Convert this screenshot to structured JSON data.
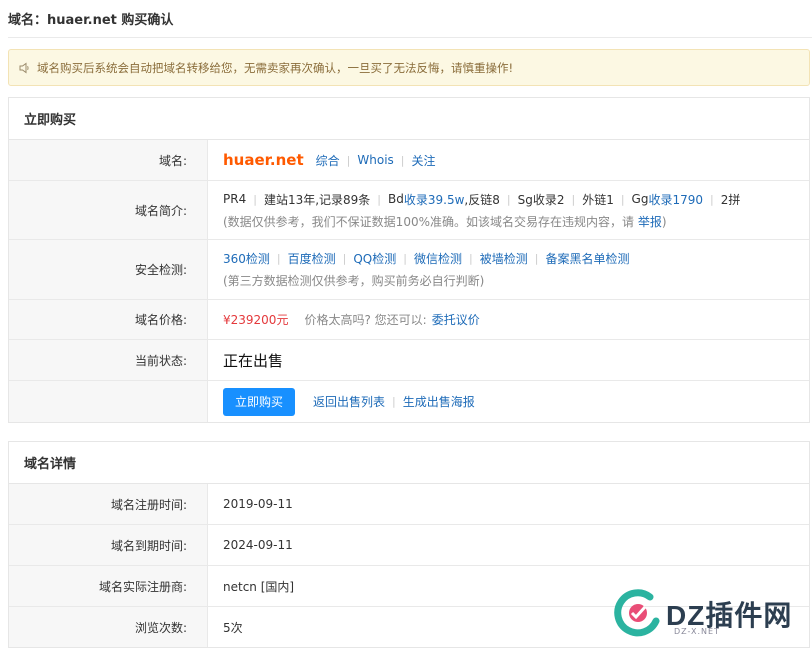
{
  "page": {
    "title": "域名：huaer.net 购买确认"
  },
  "notice": {
    "text": "域名购买后系统会自动把域名转移给您，无需卖家再次确认，一旦买了无法反悔，请慎重操作!"
  },
  "buy_panel": {
    "heading": "立即购买",
    "domain_row": {
      "label": "域名:",
      "domain": "huaer.net",
      "links": [
        "综合",
        "Whois",
        "关注"
      ]
    },
    "intro_row": {
      "label": "域名简介:",
      "seo_items": [
        {
          "prefix": "PR4",
          "highlight": ""
        },
        {
          "prefix": "建站13年,记录89条",
          "highlight": ""
        },
        {
          "prefix": "Bd",
          "highlight": "收录39.5w",
          "suffix": ",反链8"
        },
        {
          "prefix": "Sg收录2",
          "highlight": ""
        },
        {
          "prefix": "外链1",
          "highlight": ""
        },
        {
          "prefix": "Gg",
          "highlight": "收录1790"
        },
        {
          "prefix": "2拼",
          "highlight": ""
        }
      ],
      "disclaimer": "(数据仅供参考，我们不保证数据100%准确。如该域名交易存在违规内容，请 ",
      "report_link": "举报",
      "disclaimer_end": ")"
    },
    "security_row": {
      "label": "安全检测:",
      "links": [
        "360检测",
        "百度检测",
        "QQ检测",
        "微信检测",
        "被墙检测",
        "备案黑名单检测"
      ],
      "note": "(第三方数据检测仅供参考，购买前务必自行判断)"
    },
    "price_row": {
      "label": "域名价格:",
      "price": "¥239200元",
      "hint": "价格太高吗? 您还可以:",
      "link": "委托议价"
    },
    "status_row": {
      "label": "当前状态:",
      "status": "正在出售"
    },
    "actions": {
      "buy_button": "立即购买",
      "back_link": "返回出售列表",
      "poster_link": "生成出售海报"
    }
  },
  "details_panel": {
    "heading": "域名详情",
    "rows": [
      {
        "label": "域名注册时间:",
        "value": "2019-09-11"
      },
      {
        "label": "域名到期时间:",
        "value": "2024-09-11"
      },
      {
        "label": "域名实际注册商:",
        "value": "netcn [国内]"
      },
      {
        "label": "浏览次数:",
        "value": "5次"
      }
    ]
  },
  "watermark": {
    "text": "DZ插件网",
    "sub": "DZ-X.NET"
  },
  "colors": {
    "accent": "#1890ff",
    "link": "#1e6bb8",
    "price": "#e4393c",
    "domain": "#ff5a00",
    "notice_bg": "#fcf8e3"
  }
}
